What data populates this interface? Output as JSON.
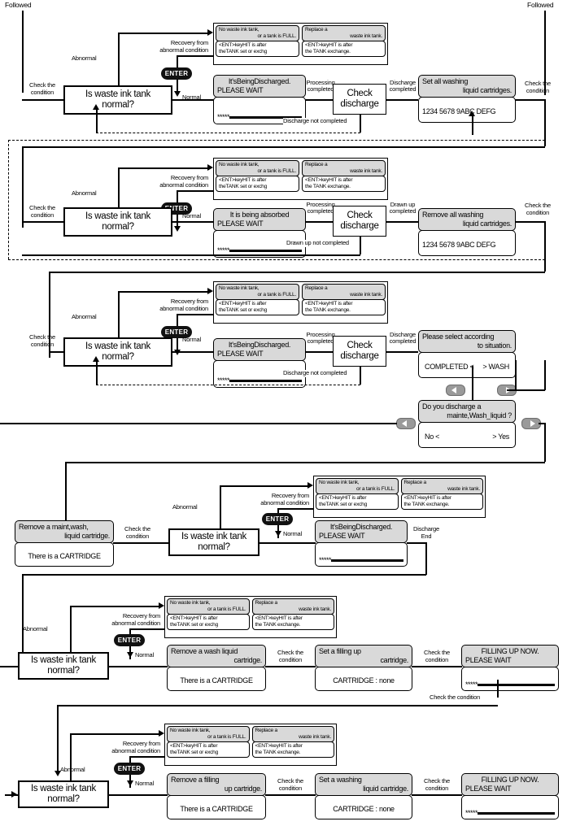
{
  "page": {
    "followed_left": "Followed",
    "followed_right": "Followed"
  },
  "common": {
    "decision": "Is waste ink tank normal?",
    "decision_l1": "Is waste ink tank",
    "decision_l2": "normal?",
    "abnormal": "Abnormal",
    "normal": "Normal",
    "recovery_l1": "Recovery from",
    "recovery_l2": "abnormal condition",
    "enter_key": "ENTER",
    "check_condition_l1": "Check the",
    "check_condition_l2": "condition",
    "check_the_condition": "Check the condition",
    "processing_l1": "Processing",
    "processing_l2": "completed",
    "alert_left": {
      "top_l1": "No waste ink tank,",
      "top_l2": "or a tank is FULL.",
      "bot_l1": "<ENT>keyHIT is after",
      "bot_l2": "theTANK set or exchg"
    },
    "alert_right": {
      "top_l1": "Replace a",
      "top_l2": "waste ink tank.",
      "bot_l1": "<ENT>keyHIT is after",
      "bot_l2": "the TANK exchange."
    },
    "progress_asterisks": "*****",
    "cartridge_present": "There is a CARTRIDGE",
    "cartridge_none": "CARTRIDGE : none",
    "check_discharge_l1": "Check",
    "check_discharge_l2": "discharge",
    "icon_left_key": "arrow-left-key",
    "icon_right_key": "arrow-right-key"
  },
  "section1": {
    "lcd_discharge": {
      "l1": "It'sBeingDischarged.",
      "l2": "PLEASE WAIT"
    },
    "label_discharge_completed_l1": "Discharge",
    "label_discharge_completed_l2": "completed",
    "label_discharge_not_completed": "Discharge not completed",
    "lcd_set_washing": {
      "l1": "Set all washing",
      "l2": "liquid cartridges.",
      "bot": "1234 5678 9ABC DEFG"
    }
  },
  "section2": {
    "lcd_absorb": {
      "l1": "It is being absorbed",
      "l2": "PLEASE WAIT"
    },
    "label_drawn_up_completed_l1": "Drawn up",
    "label_drawn_up_completed_l2": "completed",
    "label_drawn_up_not_completed": "Drawn up not completed",
    "lcd_remove_washing": {
      "l1": "Remove all washing",
      "l2": "liquid cartridges.",
      "bot": "1234 5678 9ABC DEFG"
    }
  },
  "section3": {
    "lcd_discharge": {
      "l1": "It'sBeingDischarged.",
      "l2": "PLEASE WAIT"
    },
    "label_discharge_completed_l1": "Discharge",
    "label_discharge_completed_l2": "completed",
    "label_discharge_not_completed": "Discharge not completed",
    "lcd_select": {
      "l1": "Please select according",
      "l2": "to situation.",
      "opt_left": "COMPLETED <",
      "opt_right": "> WASH"
    }
  },
  "section_prompt": {
    "lcd_prompt": {
      "l1": "Do you discharge a",
      "l2": "mainte,Wash_liquid ?",
      "opt_left": "No <",
      "opt_right": "> Yes"
    }
  },
  "section4": {
    "lcd_remove_maint": {
      "l1": "Remove a maint,wash,",
      "l2": "liquid cartridge.",
      "bot": "There is a CARTRIDGE"
    },
    "lcd_discharge": {
      "l1": "It'sBeingDischarged.",
      "l2": "PLEASE WAIT"
    },
    "label_discharge_end_l1": "Discharge",
    "label_discharge_end_l2": "End"
  },
  "section5": {
    "lcd_remove_wash": {
      "l1": "Remove a wash liquid",
      "l2": "cartridge.",
      "bot": "There is a CARTRIDGE"
    },
    "lcd_set_filling": {
      "l1": "Set a filling up",
      "l2": "cartridge.",
      "bot": "CARTRIDGE : none"
    },
    "lcd_filling": {
      "l1": "FILLING UP NOW.",
      "l2": "PLEASE WAIT"
    },
    "label_check_condition": "Check the condition"
  },
  "section6": {
    "lcd_remove_filling": {
      "l1": "Remove a filling",
      "l2": "up cartridge.",
      "bot": "There is a CARTRIDGE"
    },
    "lcd_set_washing": {
      "l1": "Set a washing",
      "l2": "liquid cartridge.",
      "bot": "CARTRIDGE : none"
    },
    "lcd_filling": {
      "l1": "FILLING UP NOW.",
      "l2": "PLEASE WAIT"
    }
  }
}
